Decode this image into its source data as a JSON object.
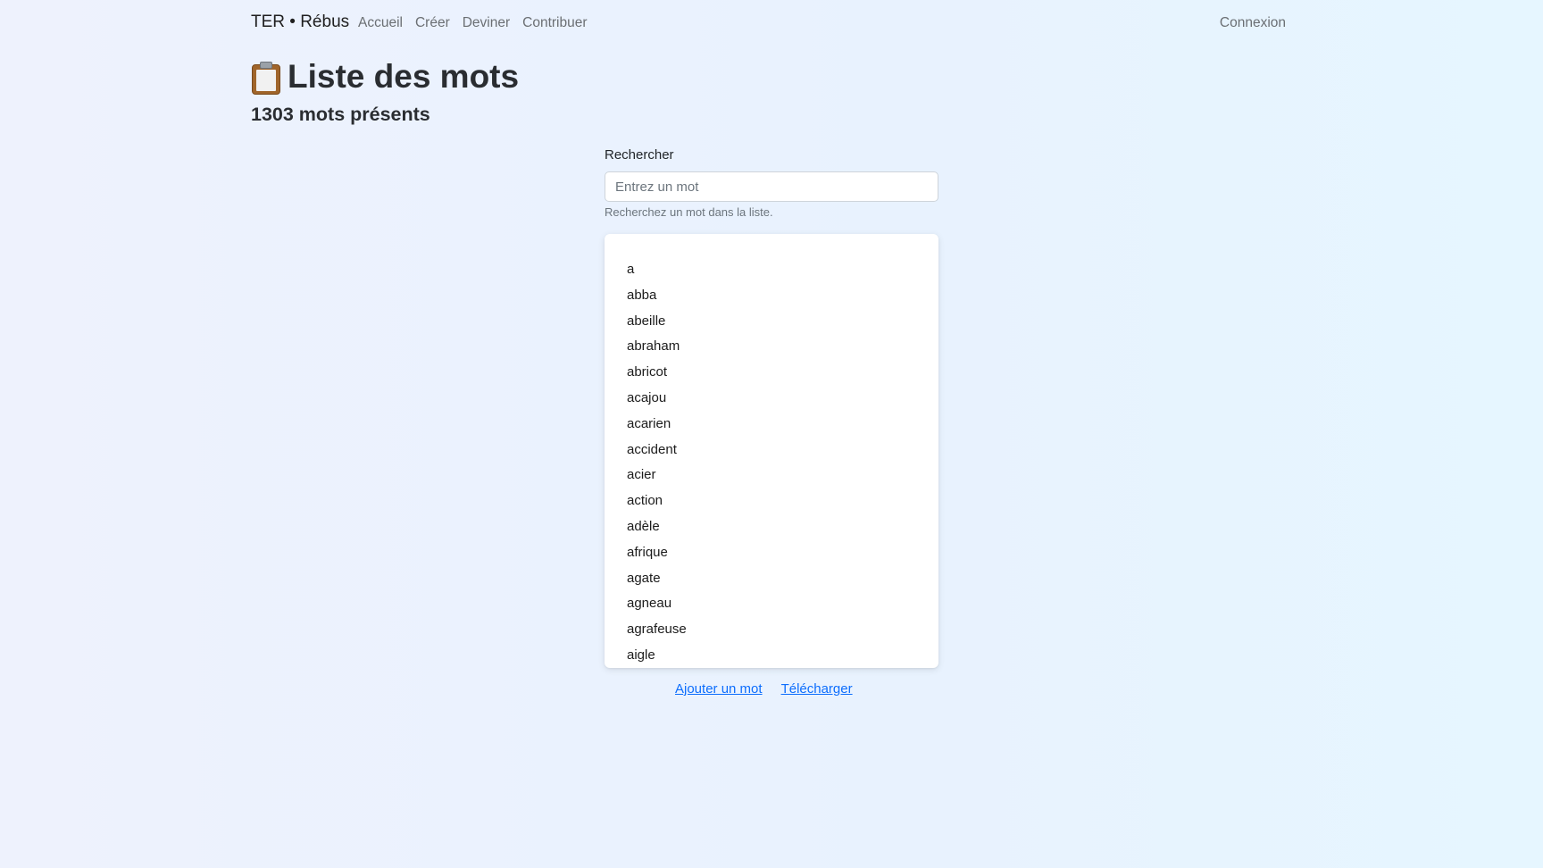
{
  "navbar": {
    "brand": "TER • Rébus",
    "links": [
      {
        "label": "Accueil"
      },
      {
        "label": "Créer"
      },
      {
        "label": "Deviner"
      },
      {
        "label": "Contribuer"
      }
    ],
    "login": "Connexion"
  },
  "page": {
    "icon": "clipboard-icon",
    "title": "Liste des mots",
    "subtitle": "1303 mots présents"
  },
  "search": {
    "label": "Rechercher",
    "placeholder": "Entrez un mot",
    "value": "",
    "help": "Recherchez un mot dans la liste."
  },
  "words": [
    "a",
    "abba",
    "abeille",
    "abraham",
    "abricot",
    "acajou",
    "acarien",
    "accident",
    "acier",
    "action",
    "adèle",
    "afrique",
    "agate",
    "agneau",
    "agrafeuse",
    "aigle"
  ],
  "footer": {
    "add_word": "Ajouter un mot",
    "download": "Télécharger"
  },
  "colors": {
    "link": "#0d6efd",
    "muted": "#6c757d",
    "text": "#212529"
  }
}
